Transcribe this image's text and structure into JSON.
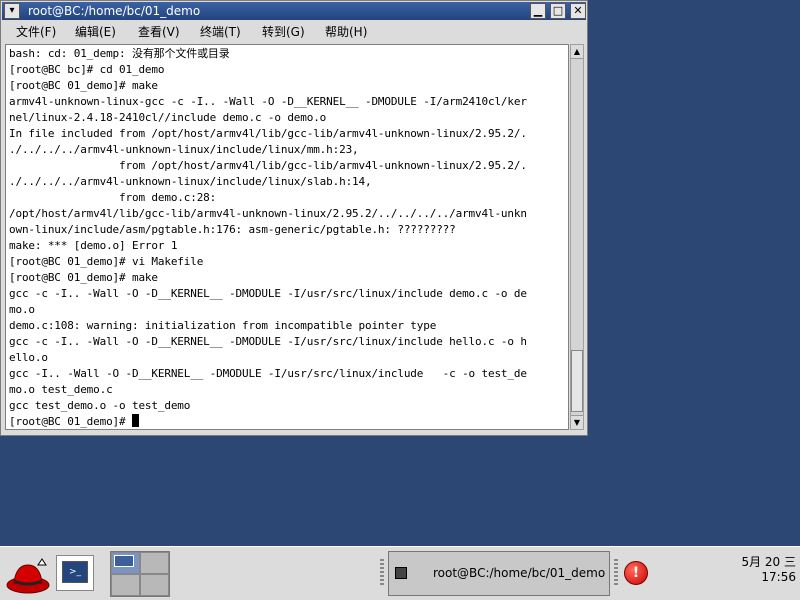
{
  "window": {
    "title": "root@BC:/home/bc/01_demo",
    "menu_btn": "▾",
    "min_btn": "▁",
    "max_btn": "□",
    "close_btn": "✕"
  },
  "menubar": {
    "items": [
      "文件(F)",
      "编辑(E)",
      "查看(V)",
      "终端(T)",
      "转到(G)",
      "帮助(H)"
    ]
  },
  "terminal": {
    "lines": [
      "bash: cd: 01_demp: 没有那个文件或目录",
      "[root@BC bc]# cd 01_demo",
      "[root@BC 01_demo]# make",
      "armv4l-unknown-linux-gcc -c -I.. -Wall -O -D__KERNEL__ -DMODULE -I/arm2410cl/ker",
      "nel/linux-2.4.18-2410cl//include demo.c -o demo.o",
      "In file included from /opt/host/armv4l/lib/gcc-lib/armv4l-unknown-linux/2.95.2/.",
      "./../../../armv4l-unknown-linux/include/linux/mm.h:23,",
      "                 from /opt/host/armv4l/lib/gcc-lib/armv4l-unknown-linux/2.95.2/.",
      "./../../../armv4l-unknown-linux/include/linux/slab.h:14,",
      "                 from demo.c:28:",
      "/opt/host/armv4l/lib/gcc-lib/armv4l-unknown-linux/2.95.2/../../../../armv4l-unkn",
      "own-linux/include/asm/pgtable.h:176: asm-generic/pgtable.h: ?????????",
      "make: *** [demo.o] Error 1",
      "[root@BC 01_demo]# vi Makefile",
      "[root@BC 01_demo]# make",
      "gcc -c -I.. -Wall -O -D__KERNEL__ -DMODULE -I/usr/src/linux/include demo.c -o de",
      "mo.o",
      "demo.c:108: warning: initialization from incompatible pointer type",
      "gcc -c -I.. -Wall -O -D__KERNEL__ -DMODULE -I/usr/src/linux/include hello.c -o h",
      "ello.o",
      "gcc -I.. -Wall -O -D__KERNEL__ -DMODULE -I/usr/src/linux/include   -c -o test_de",
      "mo.o test_demo.c",
      "gcc test_demo.o -o test_demo"
    ],
    "prompt": "[root@BC 01_demo]# "
  },
  "panel": {
    "task_label": "root@BC:/home/bc/01_demo",
    "terminal_icon_text": ">_",
    "alert_text": "!",
    "clock_date": "5月  20  三",
    "clock_time": "17:56"
  },
  "colors": {
    "desktop": "#2c4774",
    "titlebar": "#2a4c8a",
    "panel": "#dcdcdc"
  },
  "icons": [
    "window-menu-icon",
    "minimize-icon",
    "maximize-icon",
    "close-icon",
    "redhat-icon",
    "terminal-icon",
    "alert-icon"
  ]
}
